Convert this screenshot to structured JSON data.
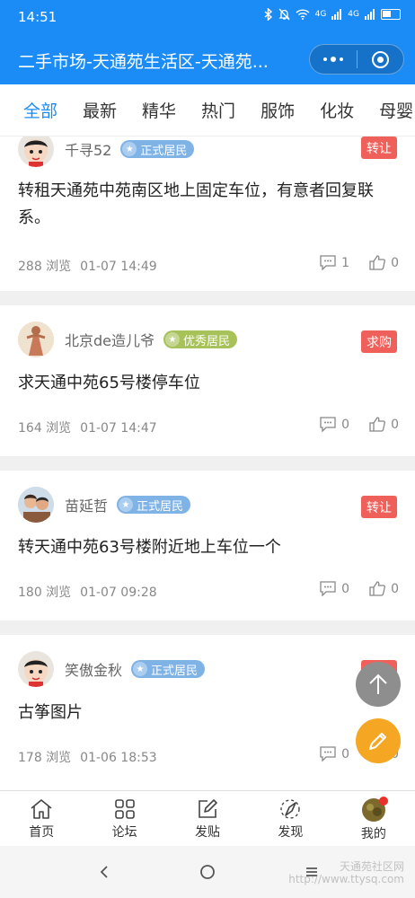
{
  "status_bar": {
    "time": "14:51",
    "signal_1": "4G",
    "signal_2": "4G"
  },
  "header": {
    "title": "二手市场-天通苑生活区-天通苑..."
  },
  "tabs": [
    {
      "label": "全部",
      "active": true
    },
    {
      "label": "最新"
    },
    {
      "label": "精华"
    },
    {
      "label": "热门"
    },
    {
      "label": "服饰"
    },
    {
      "label": "化妆"
    },
    {
      "label": "母婴"
    }
  ],
  "posts": [
    {
      "author": "千寻52",
      "level": "正式居民",
      "level_color": "#7fb3e6",
      "tag": "转让",
      "title": "转租天通苑中苑南区地上固定车位，有意者回复联系。",
      "views": "288 浏览",
      "time": "01-07 14:49",
      "comments": "1",
      "likes": "0"
    },
    {
      "author": "北京de造儿爷",
      "level": "优秀居民",
      "level_color": "#a8c25a",
      "tag": "求购",
      "title": "求天通中苑65号楼停车位",
      "views": "164 浏览",
      "time": "01-07 14:47",
      "comments": "0",
      "likes": "0"
    },
    {
      "author": "苗延哲",
      "level": "正式居民",
      "level_color": "#7fb3e6",
      "tag": "转让",
      "title": "转天通中苑63号楼附近地上车位一个",
      "views": "180 浏览",
      "time": "01-07 09:28",
      "comments": "0",
      "likes": "0"
    },
    {
      "author": "笑傲金秋",
      "level": "正式居民",
      "level_color": "#7fb3e6",
      "tag": "转让",
      "title": "古筝图片",
      "views": "178 浏览",
      "time": "01-06 18:53",
      "comments": "0",
      "likes": "0"
    }
  ],
  "bottom_nav": [
    {
      "label": "首页",
      "icon": "home-icon"
    },
    {
      "label": "论坛",
      "icon": "grid-icon"
    },
    {
      "label": "发贴",
      "icon": "edit-icon"
    },
    {
      "label": "发现",
      "icon": "compass-icon"
    },
    {
      "label": "我的",
      "icon": "avatar-icon"
    }
  ],
  "watermark": {
    "line1": "天通苑社区网",
    "line2": "http://www.ttysq.com"
  },
  "colors": {
    "primary": "#1b8cf5",
    "tag_red": "#f0605b",
    "fab_orange": "#f5a623"
  }
}
